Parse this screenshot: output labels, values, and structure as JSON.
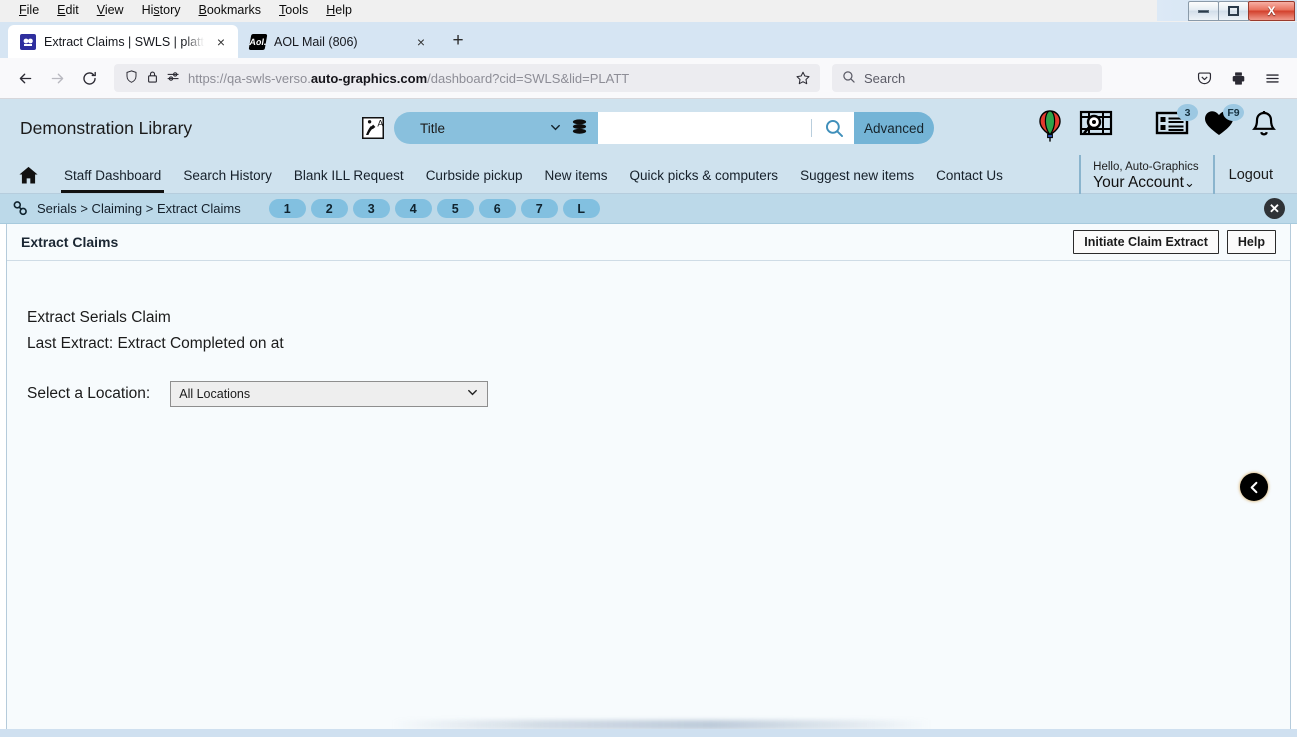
{
  "browser": {
    "menu": [
      "File",
      "Edit",
      "View",
      "History",
      "Bookmarks",
      "Tools",
      "Help"
    ],
    "tabs": [
      {
        "title": "Extract Claims | SWLS | platt | Au",
        "favicon": "verso-favicon",
        "active": true,
        "close": "×"
      },
      {
        "title": "AOL Mail (806)",
        "favicon": "aol-favicon",
        "active": false,
        "close": "×"
      }
    ],
    "new_tab_label": "+",
    "url_prefix": "https://qa-swls-verso.",
    "url_domain": "auto-graphics.com",
    "url_suffix": "/dashboard?cid=SWLS&lid=PLATT",
    "search_placeholder": "Search",
    "window_controls": {
      "minimize": "–",
      "restore": "❐",
      "close": "X"
    }
  },
  "app": {
    "library_name": "Demonstration Library",
    "search": {
      "index_label": "Title",
      "query_value": "",
      "advanced_label": "Advanced"
    },
    "header_icons": [
      {
        "name": "balloon-icon",
        "badge": ""
      },
      {
        "name": "film-search-icon",
        "badge": ""
      },
      {
        "name": "list-icon",
        "badge": "3"
      },
      {
        "name": "heart-icon",
        "badge": "F9"
      },
      {
        "name": "bell-icon",
        "badge": ""
      }
    ],
    "account": {
      "hello": "Hello, Auto-Graphics",
      "name": "Your Account",
      "chevron": "ⱟ",
      "logout": "Logout"
    },
    "nav": [
      {
        "label": "Staff Dashboard",
        "active": true
      },
      {
        "label": "Search History",
        "active": false
      },
      {
        "label": "Blank ILL Request",
        "active": false
      },
      {
        "label": "Curbside pickup",
        "active": false
      },
      {
        "label": "New items",
        "active": false
      },
      {
        "label": "Quick picks & computers",
        "active": false
      },
      {
        "label": "Suggest new items",
        "active": false
      },
      {
        "label": "Contact Us",
        "active": false
      }
    ],
    "breadcrumb": {
      "text": "Serials > Claiming > Extract Claims",
      "pills": [
        "1",
        "2",
        "3",
        "4",
        "5",
        "6",
        "7",
        "L"
      ],
      "close": "✕"
    },
    "pane": {
      "title": "Extract Claims",
      "buttons": [
        {
          "label": "Initiate Claim Extract",
          "name": "initiate-claim-extract-button"
        },
        {
          "label": "Help",
          "name": "help-button"
        }
      ],
      "heading": "Extract Serials Claim",
      "last_extract": "Last Extract: Extract Completed on at",
      "location_label": "Select a Location:",
      "location_value": "All Locations",
      "back_arrow": "‹"
    }
  },
  "colors": {
    "app_header_bg": "#cfe2ee",
    "breadcrumb_bg": "#bcd9e9",
    "pill_bg": "#82c0e0",
    "advanced_btn": "#74b4d6",
    "search_select": "#89c0dd",
    "pane_bg": "#f7fbfd"
  }
}
